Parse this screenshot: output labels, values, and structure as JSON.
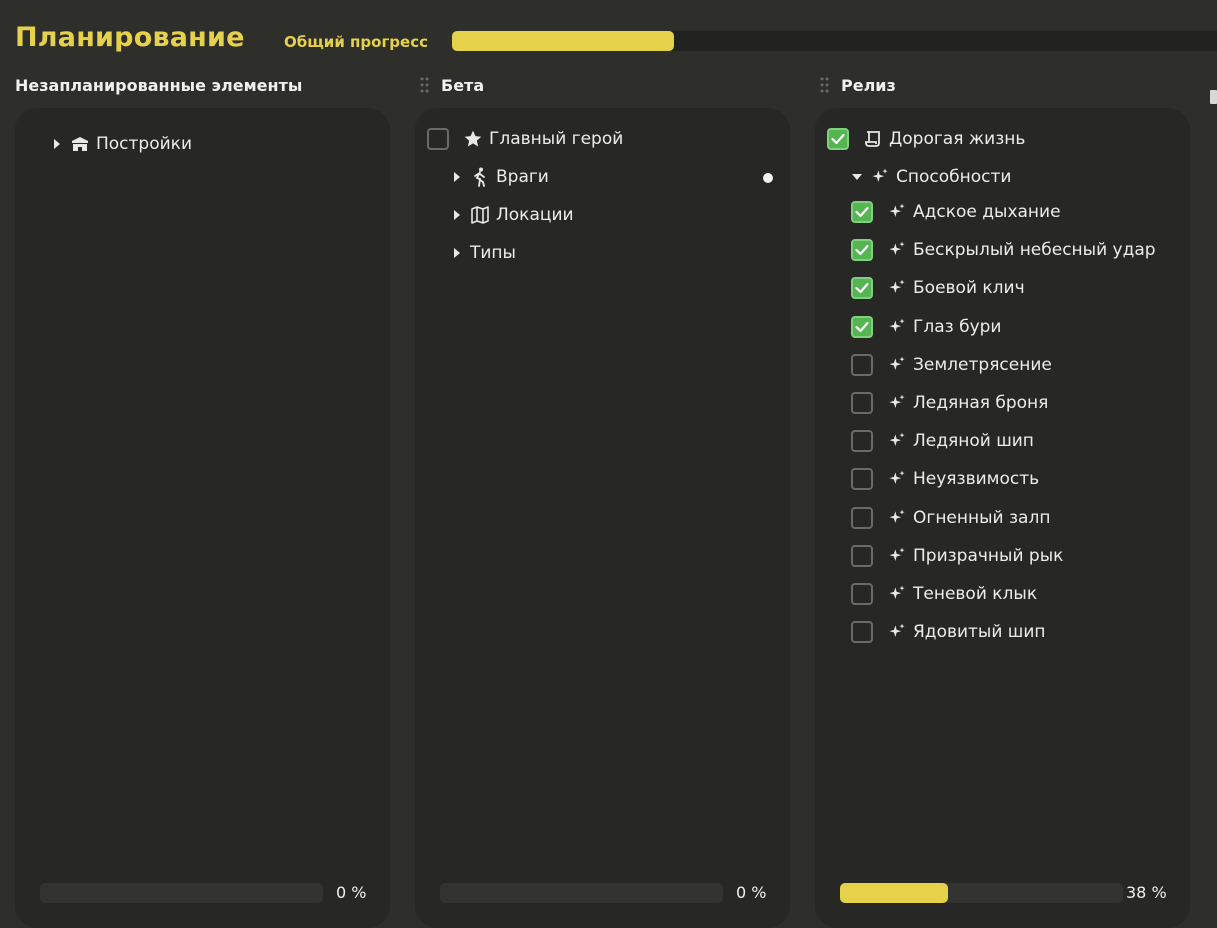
{
  "header": {
    "title": "Планирование",
    "progress_label": "Общий прогресс",
    "overall_progress_fraction": 0.29
  },
  "colors": {
    "accent": "#e6d24a",
    "check_green": "#55b553",
    "panel_bg": "#272725",
    "page_bg": "#2e2e2b"
  },
  "columns": [
    {
      "title": "Незапланированные элементы",
      "progress_text": "0 %",
      "progress_fraction": 0,
      "items": [
        {
          "label": "Постройки",
          "icon": "building-icon",
          "expandable": true,
          "expanded": false
        }
      ]
    },
    {
      "title": "Бета",
      "progress_text": "0 %",
      "progress_fraction": 0,
      "items": [
        {
          "label": "Главный герой",
          "icon": "star-icon",
          "checkbox": true,
          "checked": false
        },
        {
          "label": "Враги",
          "icon": "walking-person-icon",
          "expandable": true,
          "expanded": false,
          "has_dot": true
        },
        {
          "label": "Локации",
          "icon": "map-icon",
          "expandable": true,
          "expanded": false
        },
        {
          "label": "Типы",
          "icon": "",
          "expandable": true,
          "expanded": false
        }
      ]
    },
    {
      "title": "Релиз",
      "progress_text": "38 %",
      "progress_fraction": 0.38,
      "items": [
        {
          "label": "Дорогая жизнь",
          "icon": "scroll-icon",
          "checkbox": true,
          "checked": true
        },
        {
          "label": "Способности",
          "icon": "sparkles-icon",
          "expandable": true,
          "expanded": true
        }
      ],
      "abilities": [
        {
          "label": "Адское дыхание",
          "checked": true
        },
        {
          "label": "Бескрылый небесный удар",
          "checked": true
        },
        {
          "label": "Боевой клич",
          "checked": true
        },
        {
          "label": "Глаз бури",
          "checked": true
        },
        {
          "label": "Землетрясение",
          "checked": false
        },
        {
          "label": "Ледяная броня",
          "checked": false
        },
        {
          "label": "Ледяной шип",
          "checked": false
        },
        {
          "label": "Неуязвимость",
          "checked": false
        },
        {
          "label": "Огненный залп",
          "checked": false
        },
        {
          "label": "Призрачный рык",
          "checked": false
        },
        {
          "label": "Теневой клык",
          "checked": false
        },
        {
          "label": "Ядовитый шип",
          "checked": false
        }
      ]
    }
  ]
}
